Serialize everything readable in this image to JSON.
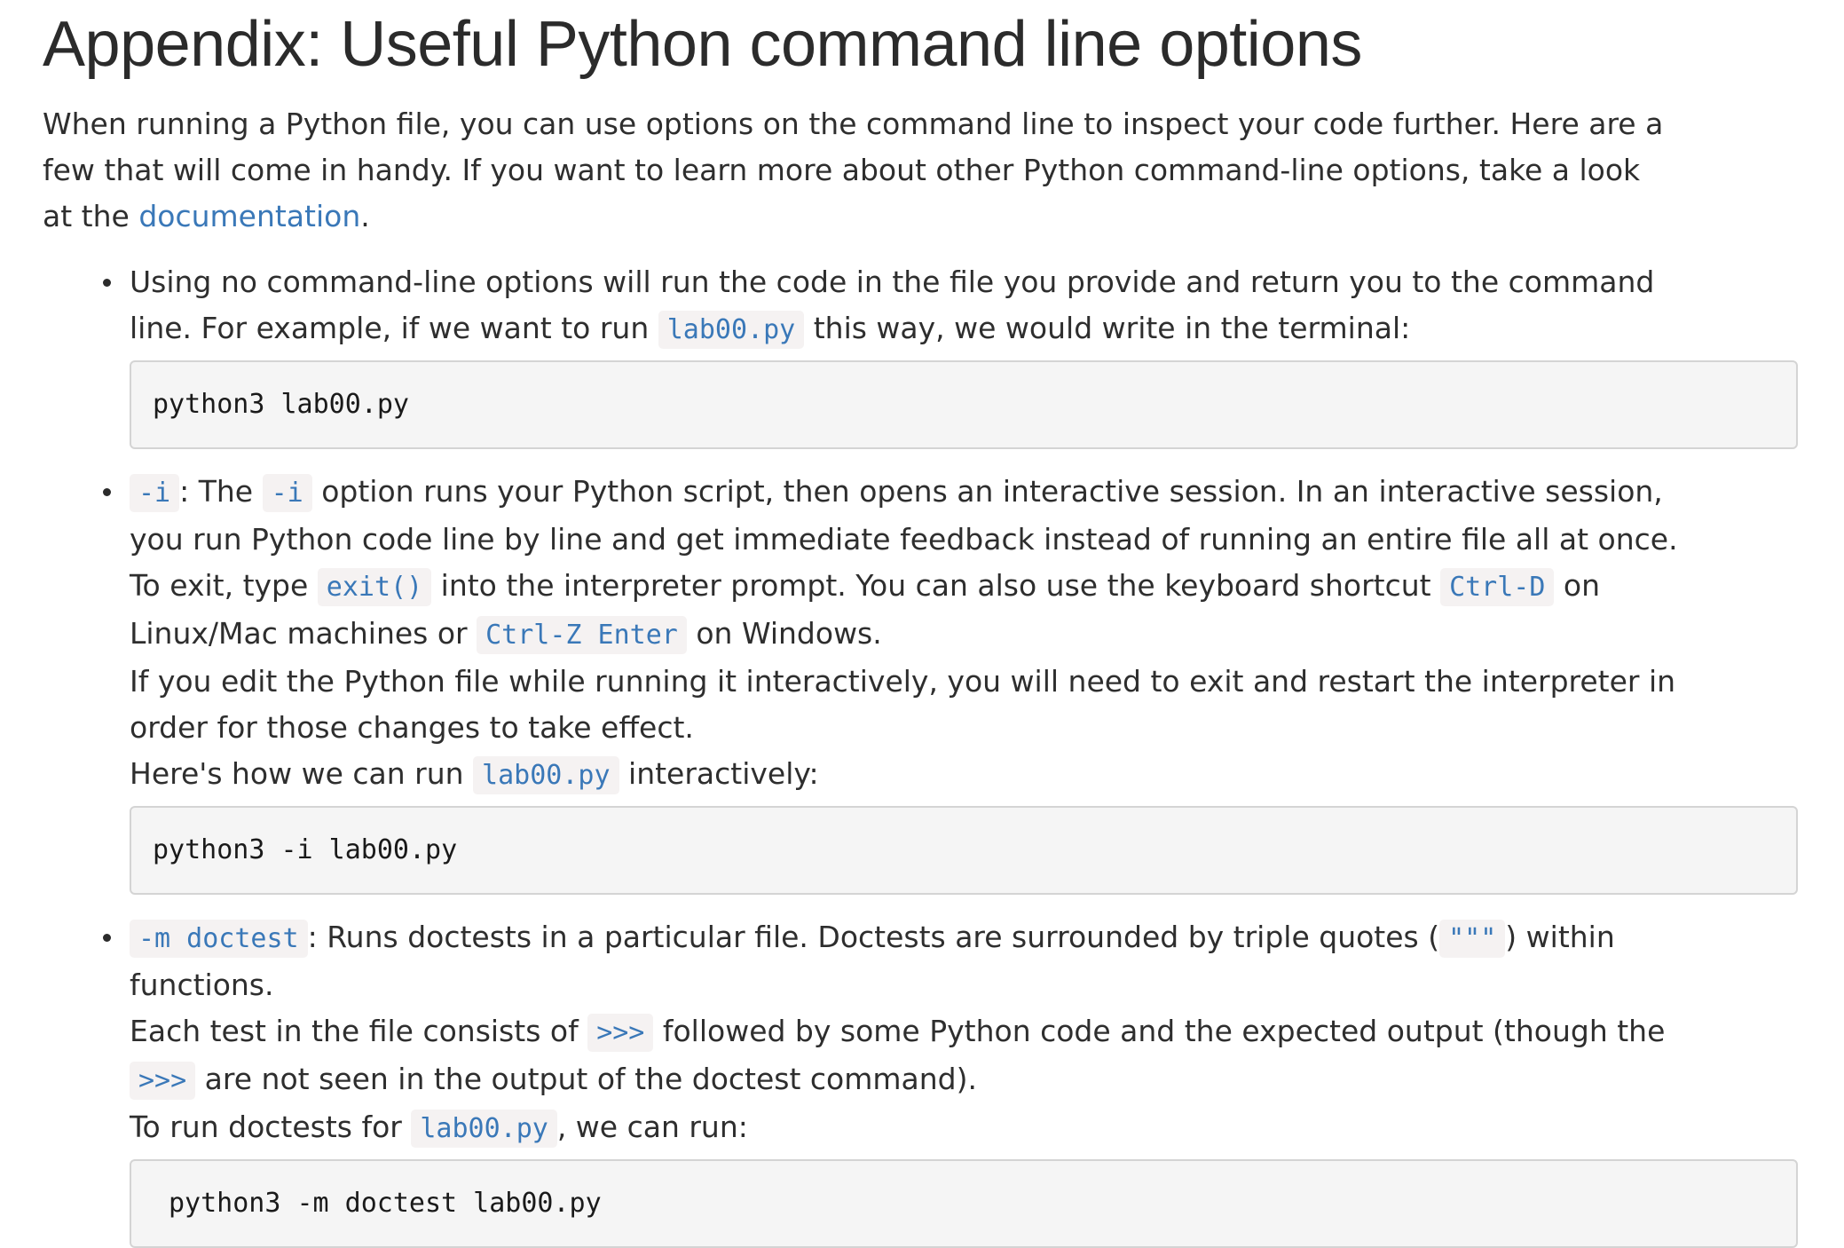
{
  "heading": "Appendix: Useful Python command line options",
  "intro": {
    "line1": "When running a Python file, you can use options on the command line to inspect your code further. Here are a",
    "line2": "few that will come in handy. If you want to learn more about other Python command-line options, take a look",
    "line3_prefix": "at the ",
    "link_text": "documentation",
    "line3_suffix": "."
  },
  "options": {
    "none": {
      "line1": "Using no command-line options will run the code in the file you provide and return you to the command",
      "line2_a": "line. For example, if we want to run ",
      "code1": "lab00.py",
      "line2_b": " this way, we would write in the terminal:",
      "codeblock": "python3 lab00.py"
    },
    "interactive": {
      "flag": "-i",
      "l1_a": ": The ",
      "l1_code": "-i",
      "l1_b": " option runs your Python script, then opens an interactive session. In an interactive session,",
      "l2": "you run Python code line by line and get immediate feedback instead of running an entire file all at once.",
      "l3_a": "To exit, type ",
      "l3_code1": "exit()",
      "l3_b": " into the interpreter prompt. You can also use the keyboard shortcut ",
      "l3_code2": "Ctrl-D",
      "l3_c": " on",
      "l4_a": "Linux/Mac machines or ",
      "l4_code": "Ctrl-Z Enter",
      "l4_b": " on Windows.",
      "l5": "If you edit the Python file while running it interactively, you will need to exit and restart the interpreter in",
      "l6": "order for those changes to take effect.",
      "l7_a": "Here's how we can run ",
      "l7_code": "lab00.py",
      "l7_b": " interactively:",
      "codeblock": "python3 -i lab00.py"
    },
    "doctest": {
      "flag": "-m doctest",
      "l1_a": ": Runs doctests in a particular file. Doctests are surrounded by triple quotes (",
      "l1_code": "\"\"\"",
      "l1_b": ") within",
      "l2": "functions.",
      "l3_a": "Each test in the file consists of ",
      "l3_code": ">>>",
      "l3_b": " followed by some Python code and the expected output (though the",
      "l4_code": ">>>",
      "l4_b": " are not seen in the output of the doctest command).",
      "l5_a": "To run doctests for ",
      "l5_code": "lab00.py",
      "l5_b": ", we can run:",
      "codeblock": "python3 -m doctest lab00.py"
    }
  },
  "colors": {
    "link": "#3a78b8",
    "text": "#2e2e2e",
    "inline_code_bg": "#f5f2f2",
    "codeblock_bg": "#f5f5f5",
    "codeblock_border": "#d4d4d4"
  }
}
